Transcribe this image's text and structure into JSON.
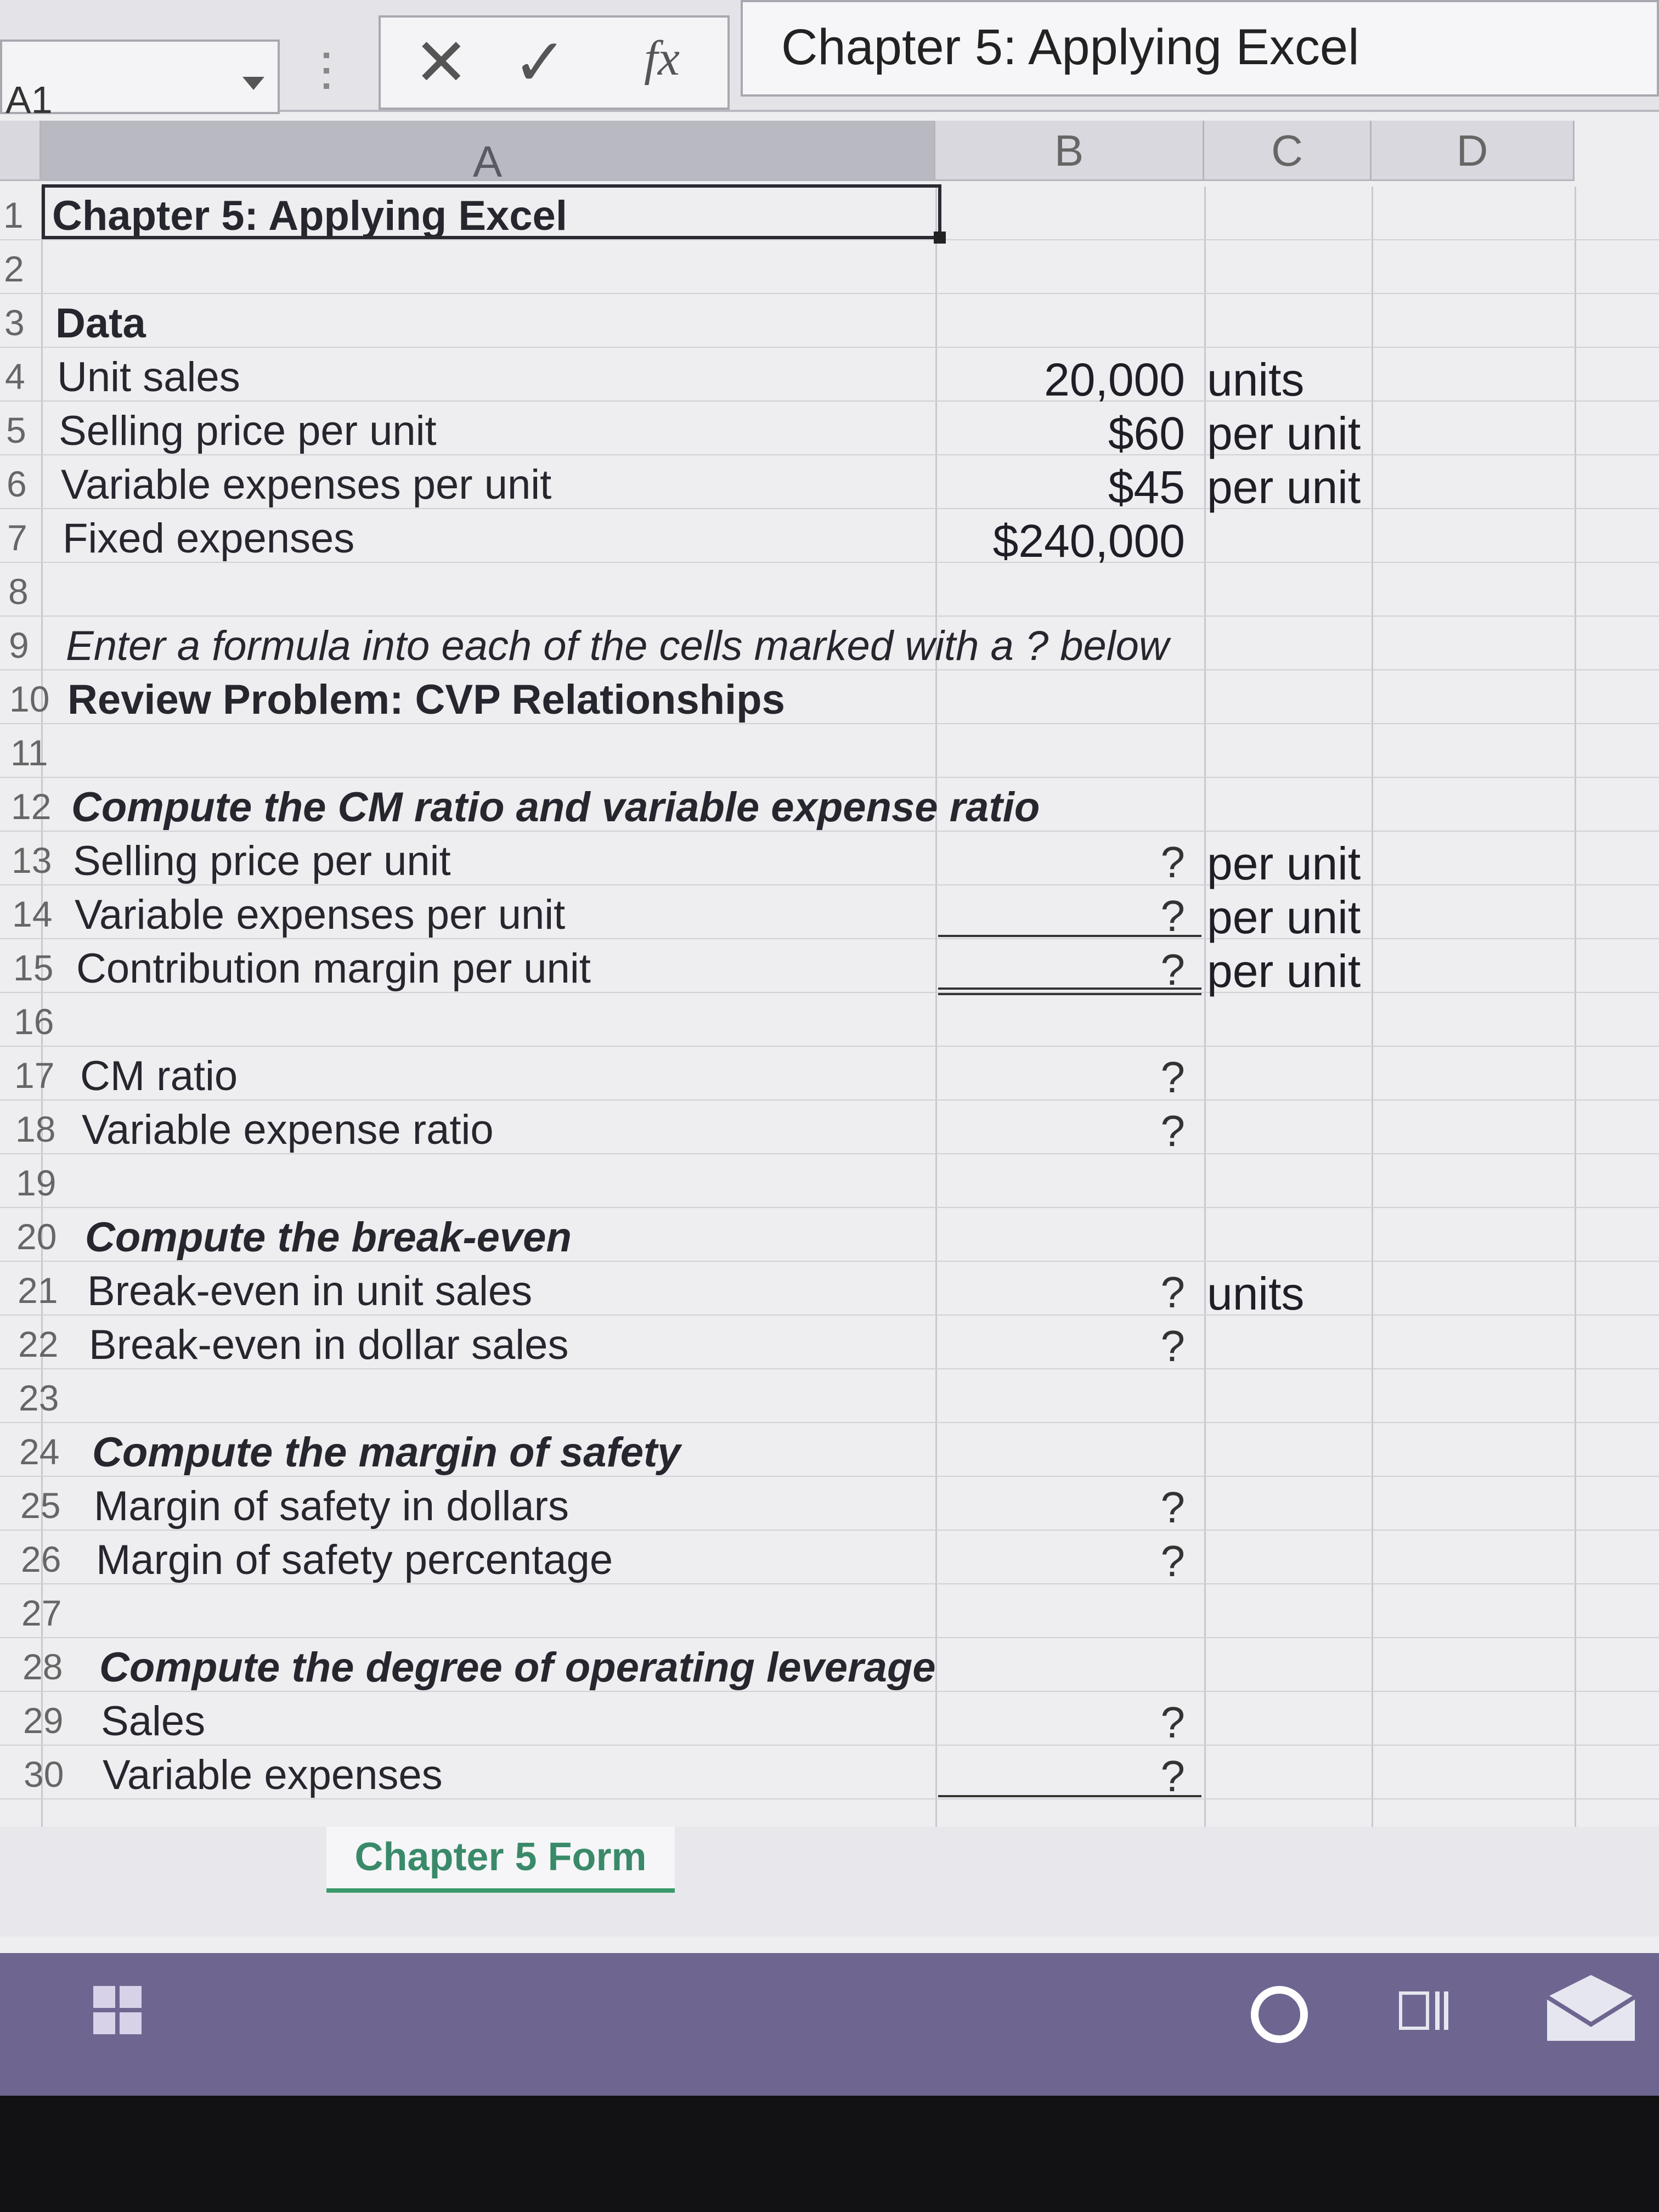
{
  "formula_bar": {
    "name_box": "A1",
    "cancel_icon": "close-icon",
    "enter_icon": "check-icon",
    "fx_label": "fx",
    "content": "Chapter 5: Applying Excel"
  },
  "columns": [
    "A",
    "B",
    "C",
    "D"
  ],
  "rows": [
    {
      "n": "1",
      "a": "Chapter 5: Applying Excel",
      "style": "bold"
    },
    {
      "n": "2",
      "a": ""
    },
    {
      "n": "3",
      "a": "Data",
      "style": "bold"
    },
    {
      "n": "4",
      "a": "Unit sales",
      "b": "20,000",
      "c": "units"
    },
    {
      "n": "5",
      "a": "Selling price per unit",
      "b": "$60",
      "c": "per unit"
    },
    {
      "n": "6",
      "a": "Variable expenses per unit",
      "b": "$45",
      "c": "per unit"
    },
    {
      "n": "7",
      "a": "Fixed expenses",
      "b": "$240,000"
    },
    {
      "n": "8",
      "a": ""
    },
    {
      "n": "9",
      "a": "Enter a formula into each of the cells marked with a ? below",
      "style": "italic"
    },
    {
      "n": "10",
      "a": "Review Problem: CVP Relationships",
      "style": "bold"
    },
    {
      "n": "11",
      "a": ""
    },
    {
      "n": "12",
      "a": "Compute the CM ratio and variable expense ratio",
      "style": "bi"
    },
    {
      "n": "13",
      "a": "Selling price per unit",
      "b": "?",
      "c": "per unit"
    },
    {
      "n": "14",
      "a": "Variable expenses per unit",
      "b": "?",
      "c": "per unit"
    },
    {
      "n": "15",
      "a": "Contribution margin per unit",
      "b": "?",
      "c": "per unit"
    },
    {
      "n": "16",
      "a": ""
    },
    {
      "n": "17",
      "a": "CM ratio",
      "b": "?"
    },
    {
      "n": "18",
      "a": "Variable expense ratio",
      "b": "?"
    },
    {
      "n": "19",
      "a": ""
    },
    {
      "n": "20",
      "a": "Compute the break-even",
      "style": "bi"
    },
    {
      "n": "21",
      "a": "Break-even in unit sales",
      "b": "?",
      "c": "units"
    },
    {
      "n": "22",
      "a": "Break-even in dollar sales",
      "b": "?"
    },
    {
      "n": "23",
      "a": ""
    },
    {
      "n": "24",
      "a": "Compute the margin of safety",
      "style": "bi"
    },
    {
      "n": "25",
      "a": "Margin of safety in dollars",
      "b": "?"
    },
    {
      "n": "26",
      "a": "Margin of safety percentage",
      "b": "?"
    },
    {
      "n": "27",
      "a": ""
    },
    {
      "n": "28",
      "a": "Compute the degree of operating leverage",
      "style": "bi"
    },
    {
      "n": "29",
      "a": "Sales",
      "b": "?"
    },
    {
      "n": "30",
      "a": "Variable expenses",
      "b": "?"
    }
  ],
  "sheet_tab": "Chapter 5 Form",
  "taskbar": {
    "icons": [
      "windows-start-icon",
      "cortana-icon",
      "task-view-icon",
      "mail-icon"
    ]
  }
}
